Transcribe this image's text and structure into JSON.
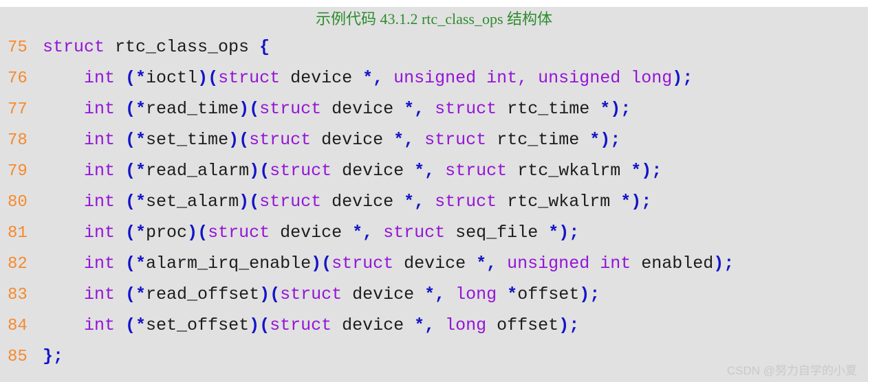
{
  "code_block": {
    "title": "示例代码 43.1.2 rtc_class_ops 结构体",
    "title_color": "#2e8b2e",
    "background_color": "#e1e1e1",
    "line_number_color": "#f58a2e",
    "keyword_color": "#9414d7",
    "identifier_color": "#1c1c1c",
    "punctuation_color": "#1414c8",
    "language": "c",
    "lines": [
      {
        "number": "75",
        "tokens": [
          {
            "text": "struct",
            "type": "kw"
          },
          {
            "text": " rtc_class_ops ",
            "type": "id"
          },
          {
            "text": "{",
            "type": "punc"
          }
        ]
      },
      {
        "number": "76",
        "tokens": [
          {
            "text": "    int ",
            "type": "kw"
          },
          {
            "text": "(*",
            "type": "punc"
          },
          {
            "text": "ioctl",
            "type": "id"
          },
          {
            "text": ")(",
            "type": "punc"
          },
          {
            "text": "struct",
            "type": "kw"
          },
          {
            "text": " device ",
            "type": "id"
          },
          {
            "text": "*,",
            "type": "punc"
          },
          {
            "text": " unsigned int, unsigned long",
            "type": "kw"
          },
          {
            "text": ");",
            "type": "punc"
          }
        ]
      },
      {
        "number": "77",
        "tokens": [
          {
            "text": "    int ",
            "type": "kw"
          },
          {
            "text": "(*",
            "type": "punc"
          },
          {
            "text": "read_time",
            "type": "id"
          },
          {
            "text": ")(",
            "type": "punc"
          },
          {
            "text": "struct",
            "type": "kw"
          },
          {
            "text": " device ",
            "type": "id"
          },
          {
            "text": "*,",
            "type": "punc"
          },
          {
            "text": " struct",
            "type": "kw"
          },
          {
            "text": " rtc_time ",
            "type": "id"
          },
          {
            "text": "*);",
            "type": "punc"
          }
        ]
      },
      {
        "number": "78",
        "tokens": [
          {
            "text": "    int ",
            "type": "kw"
          },
          {
            "text": "(*",
            "type": "punc"
          },
          {
            "text": "set_time",
            "type": "id"
          },
          {
            "text": ")(",
            "type": "punc"
          },
          {
            "text": "struct",
            "type": "kw"
          },
          {
            "text": " device ",
            "type": "id"
          },
          {
            "text": "*,",
            "type": "punc"
          },
          {
            "text": " struct",
            "type": "kw"
          },
          {
            "text": " rtc_time ",
            "type": "id"
          },
          {
            "text": "*);",
            "type": "punc"
          }
        ]
      },
      {
        "number": "79",
        "tokens": [
          {
            "text": "    int ",
            "type": "kw"
          },
          {
            "text": "(*",
            "type": "punc"
          },
          {
            "text": "read_alarm",
            "type": "id"
          },
          {
            "text": ")(",
            "type": "punc"
          },
          {
            "text": "struct",
            "type": "kw"
          },
          {
            "text": " device ",
            "type": "id"
          },
          {
            "text": "*,",
            "type": "punc"
          },
          {
            "text": " struct",
            "type": "kw"
          },
          {
            "text": " rtc_wkalrm ",
            "type": "id"
          },
          {
            "text": "*);",
            "type": "punc"
          }
        ]
      },
      {
        "number": "80",
        "tokens": [
          {
            "text": "    int ",
            "type": "kw"
          },
          {
            "text": "(*",
            "type": "punc"
          },
          {
            "text": "set_alarm",
            "type": "id"
          },
          {
            "text": ")(",
            "type": "punc"
          },
          {
            "text": "struct",
            "type": "kw"
          },
          {
            "text": " device ",
            "type": "id"
          },
          {
            "text": "*,",
            "type": "punc"
          },
          {
            "text": " struct",
            "type": "kw"
          },
          {
            "text": " rtc_wkalrm ",
            "type": "id"
          },
          {
            "text": "*);",
            "type": "punc"
          }
        ]
      },
      {
        "number": "81",
        "tokens": [
          {
            "text": "    int ",
            "type": "kw"
          },
          {
            "text": "(*",
            "type": "punc"
          },
          {
            "text": "proc",
            "type": "id"
          },
          {
            "text": ")(",
            "type": "punc"
          },
          {
            "text": "struct",
            "type": "kw"
          },
          {
            "text": " device ",
            "type": "id"
          },
          {
            "text": "*,",
            "type": "punc"
          },
          {
            "text": " struct",
            "type": "kw"
          },
          {
            "text": " seq_file ",
            "type": "id"
          },
          {
            "text": "*);",
            "type": "punc"
          }
        ]
      },
      {
        "number": "82",
        "tokens": [
          {
            "text": "    int ",
            "type": "kw"
          },
          {
            "text": "(*",
            "type": "punc"
          },
          {
            "text": "alarm_irq_enable",
            "type": "id"
          },
          {
            "text": ")(",
            "type": "punc"
          },
          {
            "text": "struct",
            "type": "kw"
          },
          {
            "text": " device ",
            "type": "id"
          },
          {
            "text": "*,",
            "type": "punc"
          },
          {
            "text": " unsigned int",
            "type": "kw"
          },
          {
            "text": " enabled",
            "type": "id"
          },
          {
            "text": ");",
            "type": "punc"
          }
        ]
      },
      {
        "number": "83",
        "tokens": [
          {
            "text": "    int ",
            "type": "kw"
          },
          {
            "text": "(*",
            "type": "punc"
          },
          {
            "text": "read_offset",
            "type": "id"
          },
          {
            "text": ")(",
            "type": "punc"
          },
          {
            "text": "struct",
            "type": "kw"
          },
          {
            "text": " device ",
            "type": "id"
          },
          {
            "text": "*,",
            "type": "punc"
          },
          {
            "text": " long ",
            "type": "kw"
          },
          {
            "text": "*",
            "type": "punc"
          },
          {
            "text": "offset",
            "type": "id"
          },
          {
            "text": ");",
            "type": "punc"
          }
        ]
      },
      {
        "number": "84",
        "tokens": [
          {
            "text": "    int ",
            "type": "kw"
          },
          {
            "text": "(*",
            "type": "punc"
          },
          {
            "text": "set_offset",
            "type": "id"
          },
          {
            "text": ")(",
            "type": "punc"
          },
          {
            "text": "struct",
            "type": "kw"
          },
          {
            "text": " device ",
            "type": "id"
          },
          {
            "text": "*,",
            "type": "punc"
          },
          {
            "text": " long",
            "type": "kw"
          },
          {
            "text": " offset",
            "type": "id"
          },
          {
            "text": ");",
            "type": "punc"
          }
        ]
      },
      {
        "number": "85",
        "tokens": [
          {
            "text": "};",
            "type": "punc"
          }
        ]
      }
    ]
  },
  "watermark": {
    "text": "CSDN @努力自学的小夏",
    "color": "#c9c9c9"
  }
}
